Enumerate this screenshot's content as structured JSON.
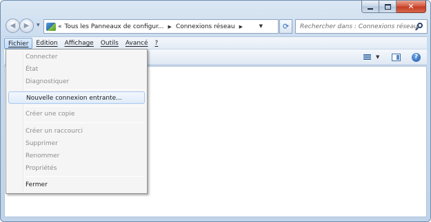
{
  "window": {
    "caption_buttons": {
      "minimize_icon": "minimize-icon",
      "maximize_icon": "maximize-icon",
      "close_glyph": "✕"
    }
  },
  "navigation": {
    "back_glyph": "◀",
    "forward_glyph": "▶",
    "breadcrumb_overflow": "«",
    "breadcrumbs": [
      {
        "label": "Tous les Panneaux de configur..."
      },
      {
        "label": "Connexions réseau"
      }
    ],
    "separator_glyph": "▶",
    "dropdown_glyph": "▼",
    "refresh_glyph": "⟳"
  },
  "search": {
    "placeholder": "Rechercher dans : Connexions réseau"
  },
  "menubar": {
    "items": [
      {
        "label": "Fichier",
        "active": true
      },
      {
        "label": "Edition",
        "active": false
      },
      {
        "label": "Affichage",
        "active": false
      },
      {
        "label": "Outils",
        "active": false
      },
      {
        "label": "Avancé",
        "active": false
      },
      {
        "label": "?",
        "active": false
      }
    ]
  },
  "commandbar": {
    "view_dropdown_glyph": "▼",
    "help_glyph": "?"
  },
  "file_menu": {
    "items": [
      {
        "label": "Connecter",
        "enabled": false
      },
      {
        "label": "État",
        "enabled": false
      },
      {
        "label": "Diagnostiquer",
        "enabled": false
      },
      {
        "label": "Nouvelle connexion entrante...",
        "enabled": true,
        "highlighted": true
      },
      {
        "label": "Créer une copie",
        "enabled": false
      },
      {
        "label": "Créer un raccourci",
        "enabled": false
      },
      {
        "label": "Supprimer",
        "enabled": false
      },
      {
        "label": "Renommer",
        "enabled": false
      },
      {
        "label": "Propriétés",
        "enabled": false
      },
      {
        "label": "Fermer",
        "enabled": true
      }
    ]
  },
  "colors": {
    "frame": "#c9dbee",
    "menu_highlight": "#c1dcf9",
    "disabled_text": "#8d8d8d"
  }
}
